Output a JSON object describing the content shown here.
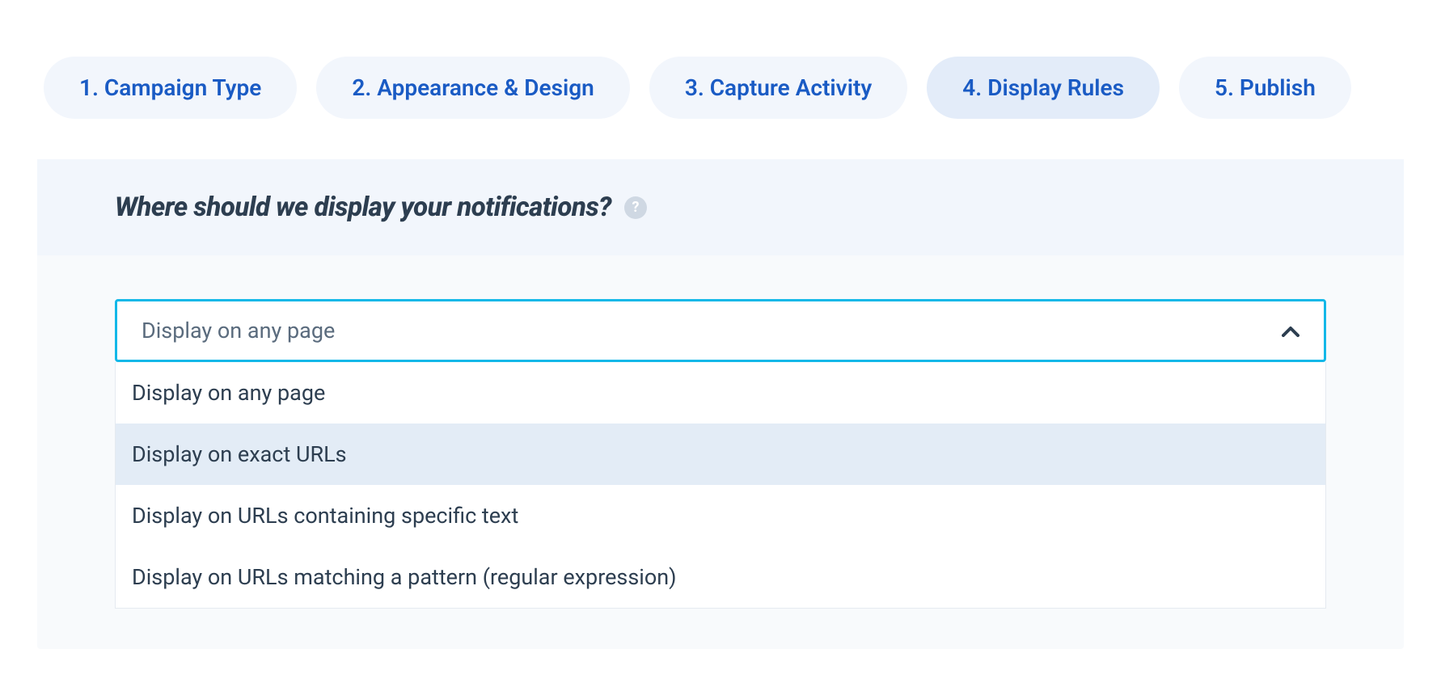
{
  "steps": [
    {
      "label": "1. Campaign Type",
      "active": false
    },
    {
      "label": "2. Appearance & Design",
      "active": false
    },
    {
      "label": "3. Capture Activity",
      "active": false
    },
    {
      "label": "4. Display Rules",
      "active": true
    },
    {
      "label": "5. Publish",
      "active": false
    }
  ],
  "panel": {
    "title": "Where should we display your notifications?"
  },
  "select": {
    "value": "Display on any page",
    "options": [
      {
        "label": "Display on any page",
        "highlighted": false
      },
      {
        "label": "Display on exact URLs",
        "highlighted": true
      },
      {
        "label": "Display on URLs containing specific text",
        "highlighted": false
      },
      {
        "label": "Display on URLs matching a pattern (regular expression)",
        "highlighted": false
      }
    ]
  }
}
